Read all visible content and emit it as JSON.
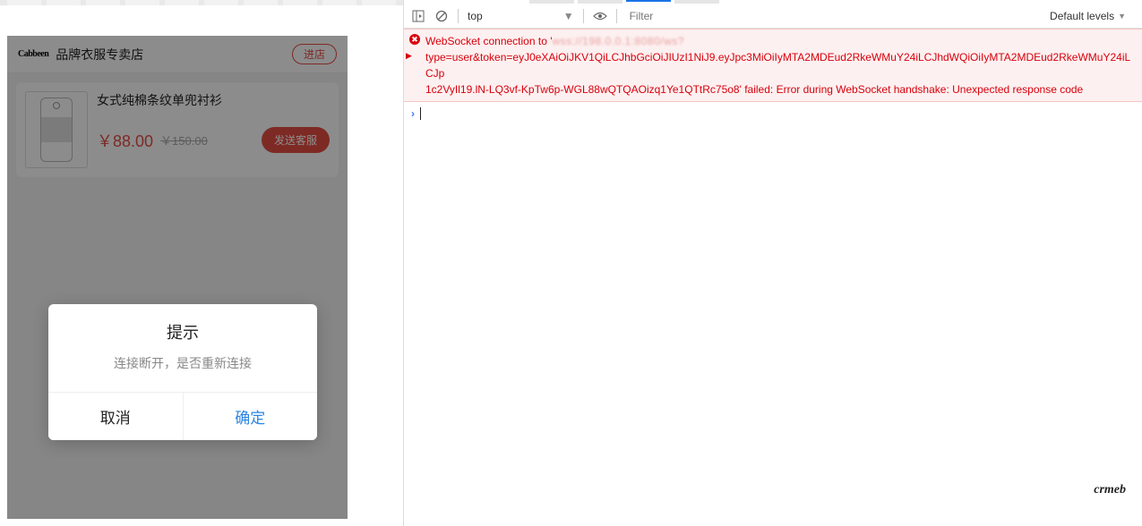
{
  "mobile": {
    "store": {
      "brand_logo_text": "Cabbeen",
      "name": "品牌衣服专卖店",
      "enter_label": "进店"
    },
    "product": {
      "title": "女式纯棉条纹单兜衬衫",
      "price_now": "￥88.00",
      "price_old": "￥150.00",
      "send_label": "发送客服"
    },
    "dialog": {
      "title": "提示",
      "message": "连接断开，是否重新连接",
      "cancel": "取消",
      "ok": "确定"
    }
  },
  "devtools": {
    "toolbar": {
      "context": "top",
      "filter_placeholder": "Filter",
      "levels_label": "Default levels"
    },
    "error": {
      "line1_prefix": "WebSocket connection to '",
      "line1_blurred": "wss://198.0.0.1:8080/ws?",
      "line2": "type=user&token=eyJ0eXAiOiJKV1QiLCJhbGciOiJIUzI1NiJ9.eyJpc3MiOiIyMTA2MDEud2RkeWMuY24iLCJhdWQiOiIyMTA2MDEud2RkeWMuY24iLCJp",
      "line3": "1c2VyIl19.lN-LQ3vf-KpTw6p-WGL88wQTQAOizq1Ye1QTtRc75o8' failed: Error during WebSocket handshake: Unexpected response code"
    },
    "watermark": "crmeb"
  }
}
